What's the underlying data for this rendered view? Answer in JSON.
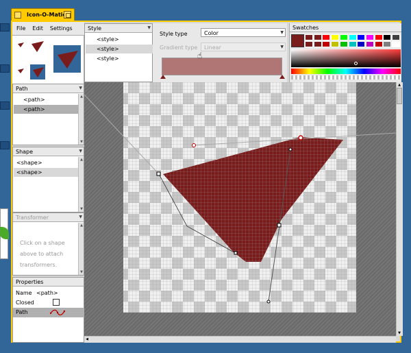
{
  "window": {
    "title": "Icon-O-Matic"
  },
  "menu": [
    "File",
    "Edit",
    "Settings"
  ],
  "style_panel": {
    "header": "Style",
    "items": [
      "<style>",
      "<style>",
      "<style>"
    ],
    "selected_index": 1
  },
  "style_editor": {
    "style_type_label": "Style type",
    "style_type_value": "Color",
    "gradient_type_label": "Gradient type",
    "gradient_type_value": "Linear",
    "current_color": "#b07575"
  },
  "swatches": {
    "header": "Swatches",
    "colors": [
      "#7a1c1c",
      "#7a1c1c",
      "#ff0000",
      "#ffff00",
      "#00ff00",
      "#00ffff",
      "#0000ff",
      "#ff00ff",
      "#ff0000",
      "#000000",
      "#404040",
      "#7a1c1c",
      "#7a1c1c",
      "#c00000",
      "#c0c000",
      "#00c000",
      "#00c0c0",
      "#0000c0",
      "#c000c0",
      "#c00000",
      "#808080",
      "#ffffff"
    ]
  },
  "path_panel": {
    "header": "Path",
    "items": [
      "<path>",
      "<path>"
    ],
    "selected_index": 1
  },
  "shape_panel": {
    "header": "Shape",
    "items": [
      "<shape>",
      "<shape>"
    ],
    "selected_index": 1
  },
  "transformer_panel": {
    "header": "Transformer",
    "hint": "Click on a shape above to attach transformers."
  },
  "properties_panel": {
    "header": "Properties",
    "name_label": "Name",
    "name_value": "<path>",
    "closed_label": "Closed",
    "closed_checked": false,
    "path_label": "Path"
  },
  "colors": {
    "accent": "#ffcb00",
    "shape_fill": "#7a1c1c",
    "desktop": "#336698"
  }
}
